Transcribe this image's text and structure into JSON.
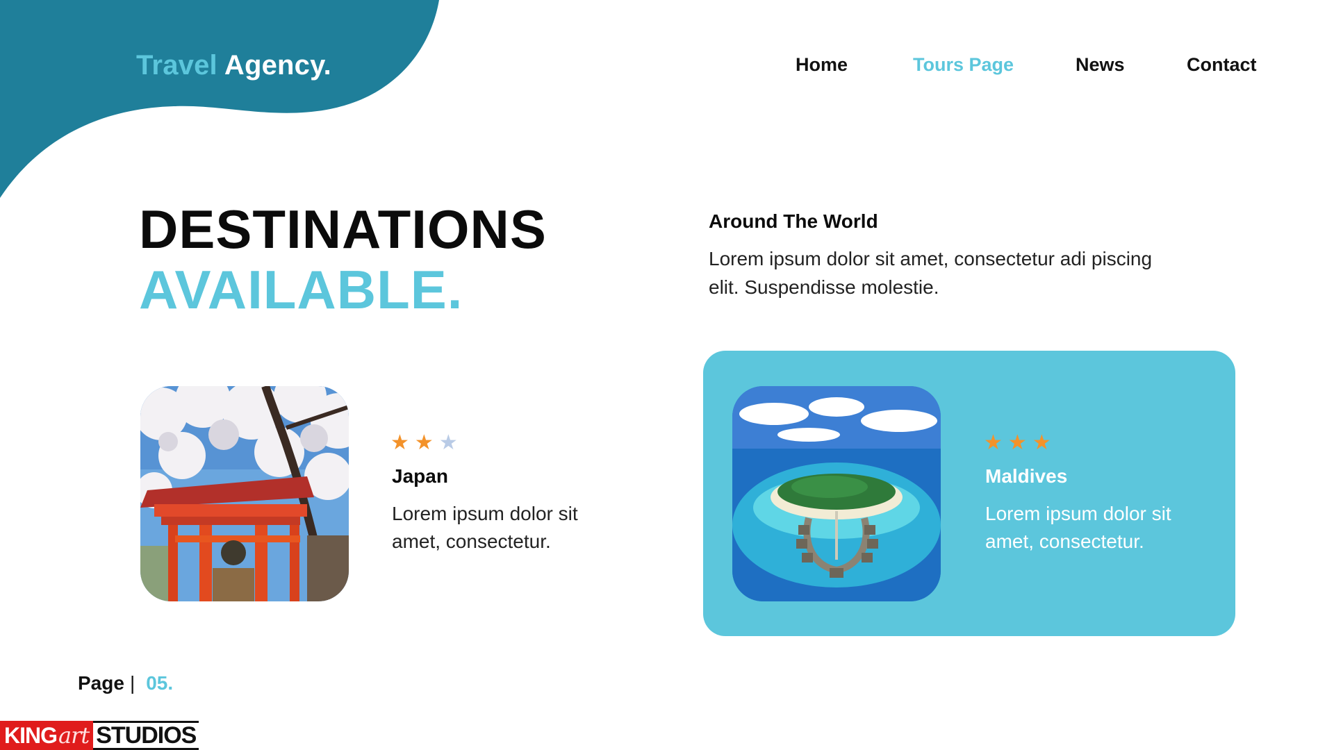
{
  "header": {
    "logo": {
      "part1": "Travel",
      "part2": "Agency."
    },
    "nav": [
      {
        "label": "Home",
        "active": false
      },
      {
        "label": "Tours Page",
        "active": true
      },
      {
        "label": "News",
        "active": false
      },
      {
        "label": "Contact",
        "active": false
      }
    ]
  },
  "hero": {
    "line1": "DESTINATIONS",
    "line2": "AVAILABLE."
  },
  "intro": {
    "title": "Around The World",
    "text": "Lorem ipsum dolor sit amet, consectetur adi piscing elit. Suspendisse molestie."
  },
  "destinations": [
    {
      "name": "Japan",
      "rating": 2,
      "rating_max": 3,
      "text": "Lorem ipsum dolor sit amet, consectetur.",
      "image": "japan-temple-photo"
    },
    {
      "name": "Maldives",
      "rating": 3,
      "rating_max": 3,
      "text": "Lorem ipsum dolor sit amet, consectetur.",
      "image": "maldives-island-photo"
    }
  ],
  "footer": {
    "page_label": "Page",
    "separator": "|",
    "page_number": "05."
  },
  "watermark": {
    "part1": "KING",
    "part2": "art",
    "part3": "STUDIOS"
  },
  "colors": {
    "primary": "#1f7f9a",
    "accent": "#5cc6dc",
    "star": "#f3922a",
    "star_empty": "#b9cbe6"
  }
}
